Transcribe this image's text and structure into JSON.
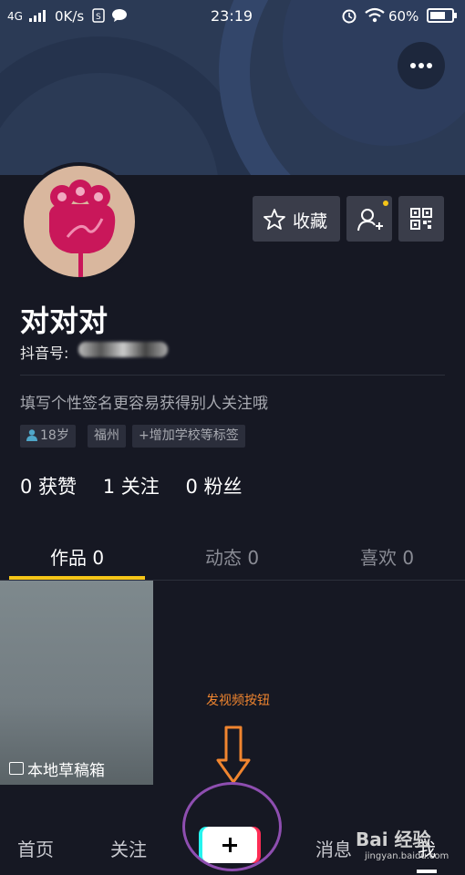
{
  "status_bar": {
    "network": "4G",
    "speed": "0K/s",
    "time": "23:19",
    "battery": "60%"
  },
  "profile": {
    "name": "对对对",
    "douyin_id_label": "抖音号:",
    "bio": "填写个性签名更容易获得别人关注哦",
    "tags": {
      "age": "18岁",
      "city": "福州",
      "school": "+增加学校等标签"
    },
    "favorite_label": "收藏"
  },
  "stats": {
    "likes": "0 获赞",
    "following": "1 关注",
    "fans": "0 粉丝"
  },
  "tabs": {
    "works": "作品 0",
    "dynamic": "动态 0",
    "likes": "喜欢 0"
  },
  "draft_label": "本地草稿箱",
  "annotation": {
    "text": "发视频按钮"
  },
  "bottom_nav": {
    "home": "首页",
    "follow": "关注",
    "messages": "消息",
    "me": "我"
  },
  "watermark": {
    "main": "Bai 经验",
    "sub": "jingyan.baidu.com"
  },
  "colors": {
    "accent": "#f5c518",
    "background": "#161823",
    "annotation": "#f0852f",
    "circle": "#8e4eb0"
  },
  "icons": [
    "signal-icon",
    "wechat-icon",
    "alarm-icon",
    "wifi-icon",
    "battery-icon",
    "more-icon",
    "star-icon",
    "add-friend-icon",
    "qr-code-icon",
    "person-icon",
    "box-icon",
    "plus-icon",
    "arrow-down-icon"
  ]
}
